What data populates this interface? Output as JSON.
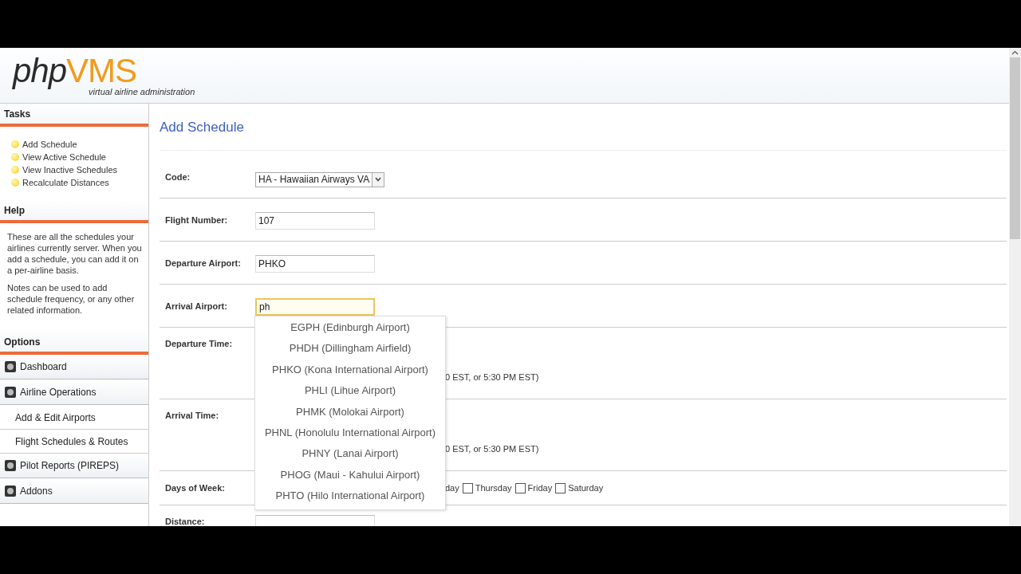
{
  "header": {
    "logo_main": "php",
    "logo_accent": "VMS",
    "tagline": "virtual airline administration"
  },
  "sidebar": {
    "tasks": {
      "title": "Tasks",
      "items": [
        "Add Schedule",
        "View Active Schedule",
        "View Inactive Schedules",
        "Recalculate Distances"
      ]
    },
    "help": {
      "title": "Help",
      "paragraphs": [
        "These are all the schedules your airlines currently server. When you add a schedule, you can add it on a per-airline basis.",
        "Notes can be used to add schedule frequency, or any other related information."
      ]
    },
    "options": {
      "title": "Options",
      "items": [
        {
          "label": "Dashboard",
          "kind": "top"
        },
        {
          "label": "Airline Operations",
          "kind": "top"
        },
        {
          "label": "Add & Edit Airports",
          "kind": "sub"
        },
        {
          "label": "Flight Schedules & Routes",
          "kind": "sub"
        },
        {
          "label": "Pilot Reports (PIREPS)",
          "kind": "top"
        },
        {
          "label": "Addons",
          "kind": "top"
        }
      ]
    }
  },
  "page_title": "Add Schedule",
  "form": {
    "rows": [
      {
        "label": "Code:",
        "kind": "select",
        "value": "HA - Hawaiian Airways VA"
      },
      {
        "label": "Flight Number:",
        "kind": "text",
        "value": "107",
        "focused": false
      },
      {
        "label": "Departure Airport:",
        "kind": "text",
        "value": "PHKO",
        "focused": false
      },
      {
        "label": "Arrival Airport:",
        "kind": "text",
        "value": "ph",
        "focused": true
      },
      {
        "label": "Departure Time:",
        "kind": "hint",
        "hint": "0 EST, or 5:30 PM EST)"
      },
      {
        "label": "Arrival Time:",
        "kind": "hint",
        "hint": "0 EST, or 5:30 PM EST)"
      },
      {
        "label": "Days of Week:",
        "kind": "days",
        "fragment": "day",
        "days": [
          {
            "label": "Thursday",
            "checked": false
          },
          {
            "label": "Friday",
            "checked": false
          },
          {
            "label": "Saturday",
            "checked": false
          }
        ]
      },
      {
        "label": "Distance:",
        "kind": "text",
        "focused": false
      }
    ]
  },
  "autocomplete": {
    "items": [
      "EGPH (Edinburgh Airport)",
      "PHDH (Dillingham Airfield)",
      "PHKO (Kona International Airport)",
      "PHLI (Lihue Airport)",
      "PHMK (Molokai Airport)",
      "PHNL (Honolulu International Airport)",
      "PHNY (Lanai Airport)",
      "PHOG (Maui - Kahului Airport)",
      "PHTO (Hilo International Airport)"
    ]
  }
}
